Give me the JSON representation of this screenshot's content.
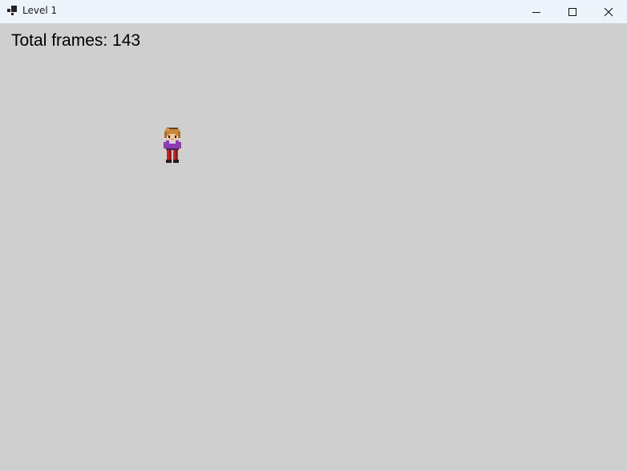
{
  "window": {
    "title": "Level 1",
    "icon": "app-window-icon",
    "controls": {
      "minimize_icon": "minimize-icon",
      "maximize_icon": "maximize-icon",
      "close_icon": "close-icon"
    }
  },
  "game": {
    "frames_label": "Total frames: 143",
    "background_color": "#cfcfcf",
    "sprite": "player-character"
  }
}
